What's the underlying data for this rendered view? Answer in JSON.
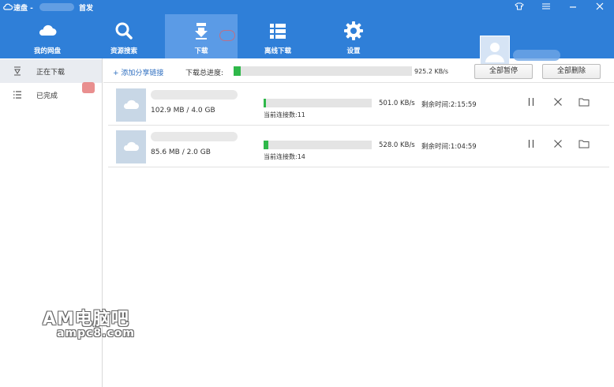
{
  "titlebar": {
    "app_name": "速盘 -",
    "home_link": "首发"
  },
  "nav": [
    {
      "label": "我的网盘",
      "icon": "cloud-icon"
    },
    {
      "label": "资源搜索",
      "icon": "search-icon"
    },
    {
      "label": "下载",
      "icon": "download-icon",
      "active": true
    },
    {
      "label": "离线下载",
      "icon": "list-icon"
    },
    {
      "label": "设置",
      "icon": "gear-icon"
    }
  ],
  "sidebar": {
    "items": [
      {
        "label": "正在下载",
        "icon": "download-funnel-icon",
        "active": true
      },
      {
        "label": "已完成",
        "icon": "list-icon"
      }
    ]
  },
  "subbar": {
    "add_link": "+ 添加分享链接",
    "total_label": "下载总进度:",
    "total_progress": 0.04,
    "total_speed": "925.2 KB/s",
    "pause_all": "全部暂停",
    "delete_all": "全部删除"
  },
  "tasks": [
    {
      "size": "102.9 MB / 4.0 GB",
      "progress": 0.025,
      "speed": "501.0 KB/s",
      "remaining": "剩余时间:2:15:59",
      "connections": "当前连接数:11"
    },
    {
      "size": "85.6 MB / 2.0 GB",
      "progress": 0.042,
      "speed": "528.0 KB/s",
      "remaining": "剩余时间:1:04:59",
      "connections": "当前连接数:14"
    }
  ],
  "watermark": {
    "line1": "AM电脑吧",
    "line2": "ampc8.com"
  },
  "colors": {
    "brand": "#2f7fd8",
    "progress": "#2fb84a",
    "link": "#2f6fc0"
  }
}
